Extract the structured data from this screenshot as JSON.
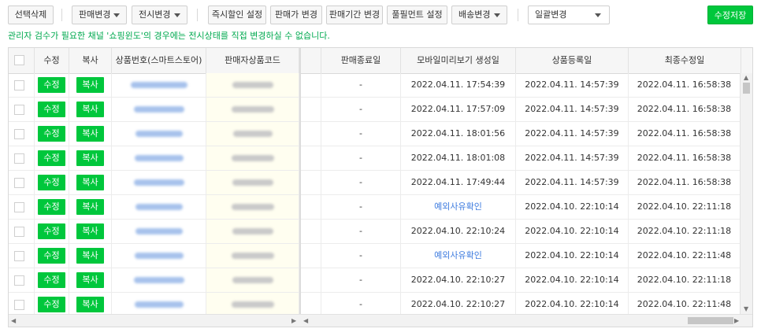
{
  "toolbar": {
    "delete_selected": "선택삭제",
    "sales_change": "판매변경",
    "display_change": "전시변경",
    "instant_discount": "즉시할인 설정",
    "price_change": "판매가 변경",
    "sales_period_change": "판매기간 변경",
    "fulfillment_setting": "풀필먼트 설정",
    "shipping_change": "배송변경",
    "bulk_change_select": "일괄변경",
    "save": "수정저장"
  },
  "notice": "관리자 검수가 필요한 채널 '쇼핑윈도'의 경우에는 전시상태를 직접 변경하실 수 없습니다.",
  "columns": {
    "edit": "수정",
    "copy": "복사",
    "product_no": "상품번호(스마트스토어)",
    "seller_code": "판매자상품코드",
    "sales_end": "판매종료일",
    "mobile_preview": "모바일미리보기 생성일",
    "registered": "상품등록일",
    "modified": "최종수정일"
  },
  "buttons": {
    "edit": "수정",
    "copy": "복사"
  },
  "rows": [
    {
      "sales_end": "-",
      "mobile_preview": "2022.04.11. 17:54:39",
      "preview_is_link": false,
      "registered": "2022.04.11. 14:57:39",
      "modified": "2022.04.11. 16:58:38"
    },
    {
      "sales_end": "-",
      "mobile_preview": "2022.04.11. 17:57:09",
      "preview_is_link": false,
      "registered": "2022.04.11. 14:57:39",
      "modified": "2022.04.11. 16:58:38"
    },
    {
      "sales_end": "-",
      "mobile_preview": "2022.04.11. 18:01:56",
      "preview_is_link": false,
      "registered": "2022.04.11. 14:57:39",
      "modified": "2022.04.11. 16:58:38"
    },
    {
      "sales_end": "-",
      "mobile_preview": "2022.04.11. 18:01:08",
      "preview_is_link": false,
      "registered": "2022.04.11. 14:57:39",
      "modified": "2022.04.11. 16:58:38"
    },
    {
      "sales_end": "-",
      "mobile_preview": "2022.04.11. 17:49:44",
      "preview_is_link": false,
      "registered": "2022.04.11. 14:57:39",
      "modified": "2022.04.11. 16:58:38"
    },
    {
      "sales_end": "-",
      "mobile_preview": "예외사유확인",
      "preview_is_link": true,
      "registered": "2022.04.10. 22:10:14",
      "modified": "2022.04.10. 22:11:18"
    },
    {
      "sales_end": "-",
      "mobile_preview": "2022.04.10. 22:10:24",
      "preview_is_link": false,
      "registered": "2022.04.10. 22:10:14",
      "modified": "2022.04.10. 22:11:18"
    },
    {
      "sales_end": "-",
      "mobile_preview": "예외사유확인",
      "preview_is_link": true,
      "registered": "2022.04.10. 22:10:14",
      "modified": "2022.04.10. 22:11:48"
    },
    {
      "sales_end": "-",
      "mobile_preview": "2022.04.10. 22:10:27",
      "preview_is_link": false,
      "registered": "2022.04.10. 22:10:14",
      "modified": "2022.04.10. 22:11:18"
    },
    {
      "sales_end": "-",
      "mobile_preview": "2022.04.10. 22:10:27",
      "preview_is_link": false,
      "registered": "2022.04.10. 22:10:14",
      "modified": "2022.04.10. 22:11:48"
    }
  ],
  "colors": {
    "accent": "#00c73c",
    "notice": "#00a94f",
    "link": "#3d7bdf"
  }
}
